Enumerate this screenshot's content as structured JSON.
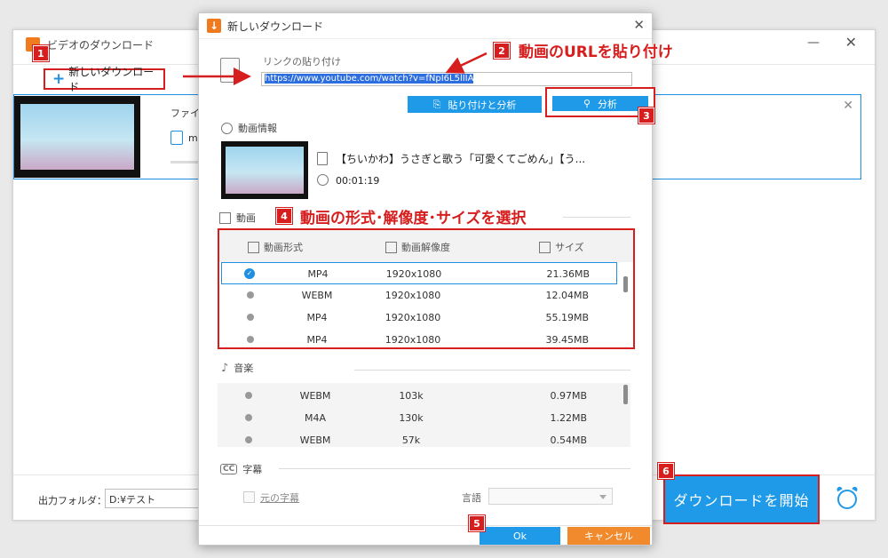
{
  "main": {
    "title": "ビデオのダウンロード",
    "minimize": "—",
    "close": "✕",
    "new_download": "新しいダウンロード",
    "task": {
      "file_label": "ファイル名",
      "file_text": "mp",
      "close": "✕"
    },
    "folder_label": "出力フォルダ：",
    "folder_value": "D:¥テスト",
    "start_button": "ダウンロードを開始"
  },
  "dialog": {
    "title": "新しいダウンロード",
    "close": "✕",
    "link_label": "リンクの貼り付け",
    "url": "https://www.youtube.com/watch?v=fNpI6L5lIIA",
    "paste_analyze": "貼り付けと分析",
    "analyze": "分析",
    "info_header": "動画情報",
    "video_title": "【ちいかわ】うさぎと歌う「可愛くてごめん」【う...",
    "duration": "00:01:19",
    "video_section": "動画",
    "video_columns": [
      "動画形式",
      "動画解像度",
      "サイズ"
    ],
    "video_rows": [
      {
        "format": "MP4",
        "resolution": "1920x1080",
        "size": "21.36MB",
        "selected": true
      },
      {
        "format": "WEBM",
        "resolution": "1920x1080",
        "size": "12.04MB",
        "selected": false
      },
      {
        "format": "MP4",
        "resolution": "1920x1080",
        "size": "55.19MB",
        "selected": false
      },
      {
        "format": "MP4",
        "resolution": "1920x1080",
        "size": "39.45MB",
        "selected": false
      }
    ],
    "music_section": "音楽",
    "audio_rows": [
      {
        "format": "WEBM",
        "bitrate": "103k",
        "size": "0.97MB"
      },
      {
        "format": "M4A",
        "bitrate": "130k",
        "size": "1.22MB"
      },
      {
        "format": "WEBM",
        "bitrate": "57k",
        "size": "0.54MB"
      }
    ],
    "subtitle_section": "字幕",
    "original_subtitle": "元の字幕",
    "language_label": "言語",
    "ok": "Ok",
    "cancel": "キャンセル"
  },
  "annotations": {
    "badges": [
      "1",
      "2",
      "3",
      "4",
      "5",
      "6"
    ],
    "callout_2": "動画のURLを貼り付け",
    "callout_4": "動画の形式･解像度･サイズを選択"
  },
  "colors": {
    "accent": "#1e9ae8",
    "annotation": "#d71e1e",
    "cancel": "#f08a2d"
  }
}
